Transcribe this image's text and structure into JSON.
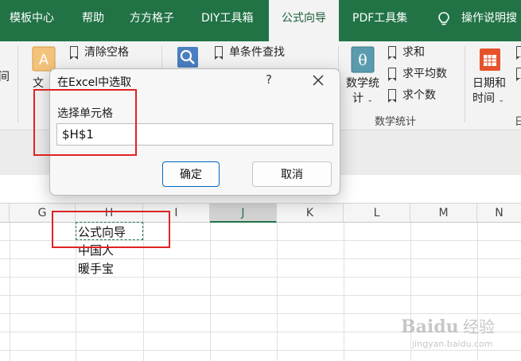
{
  "ribbon_tabs": [
    {
      "label": "模板中心",
      "active": false
    },
    {
      "label": "帮助",
      "active": false
    },
    {
      "label": "方方格子",
      "active": false
    },
    {
      "label": "DIY工具箱",
      "active": false
    },
    {
      "label": "公式向导",
      "active": true
    },
    {
      "label": "PDF工具集",
      "active": false
    },
    {
      "label": "操作说明搜",
      "active": false
    }
  ],
  "ribbon": {
    "text_group_label": "文",
    "clear_spaces": "清除空格",
    "single_lookup": "单条件查找",
    "math_stats_label_1": "数学统",
    "math_stats_label_2": "计",
    "sum": "求和",
    "average": "求平均数",
    "count": "求个数",
    "math_group_name": "数学统计",
    "datetime_label_1": "日期和",
    "datetime_label_2": "时间",
    "date_group_partial": "日"
  },
  "grid": {
    "columns": [
      "G",
      "H",
      "I",
      "J",
      "K",
      "L",
      "M",
      "N"
    ],
    "selected_column": "J",
    "cells": {
      "H1": "公式向导",
      "H2": "中国人",
      "H3": "暖手宝"
    }
  },
  "dialog": {
    "title": "在Excel中选取",
    "help": "?",
    "label": "选择单元格",
    "value": "$H$1",
    "ok": "确定",
    "cancel": "取消"
  },
  "watermark": {
    "brand": "Baidu",
    "brand_cn": "经验",
    "url": "jingyan.baidu.com"
  },
  "colors": {
    "ribbon_green": "#217346",
    "highlight_red": "#e02323",
    "primary_blue": "#0067c0"
  }
}
